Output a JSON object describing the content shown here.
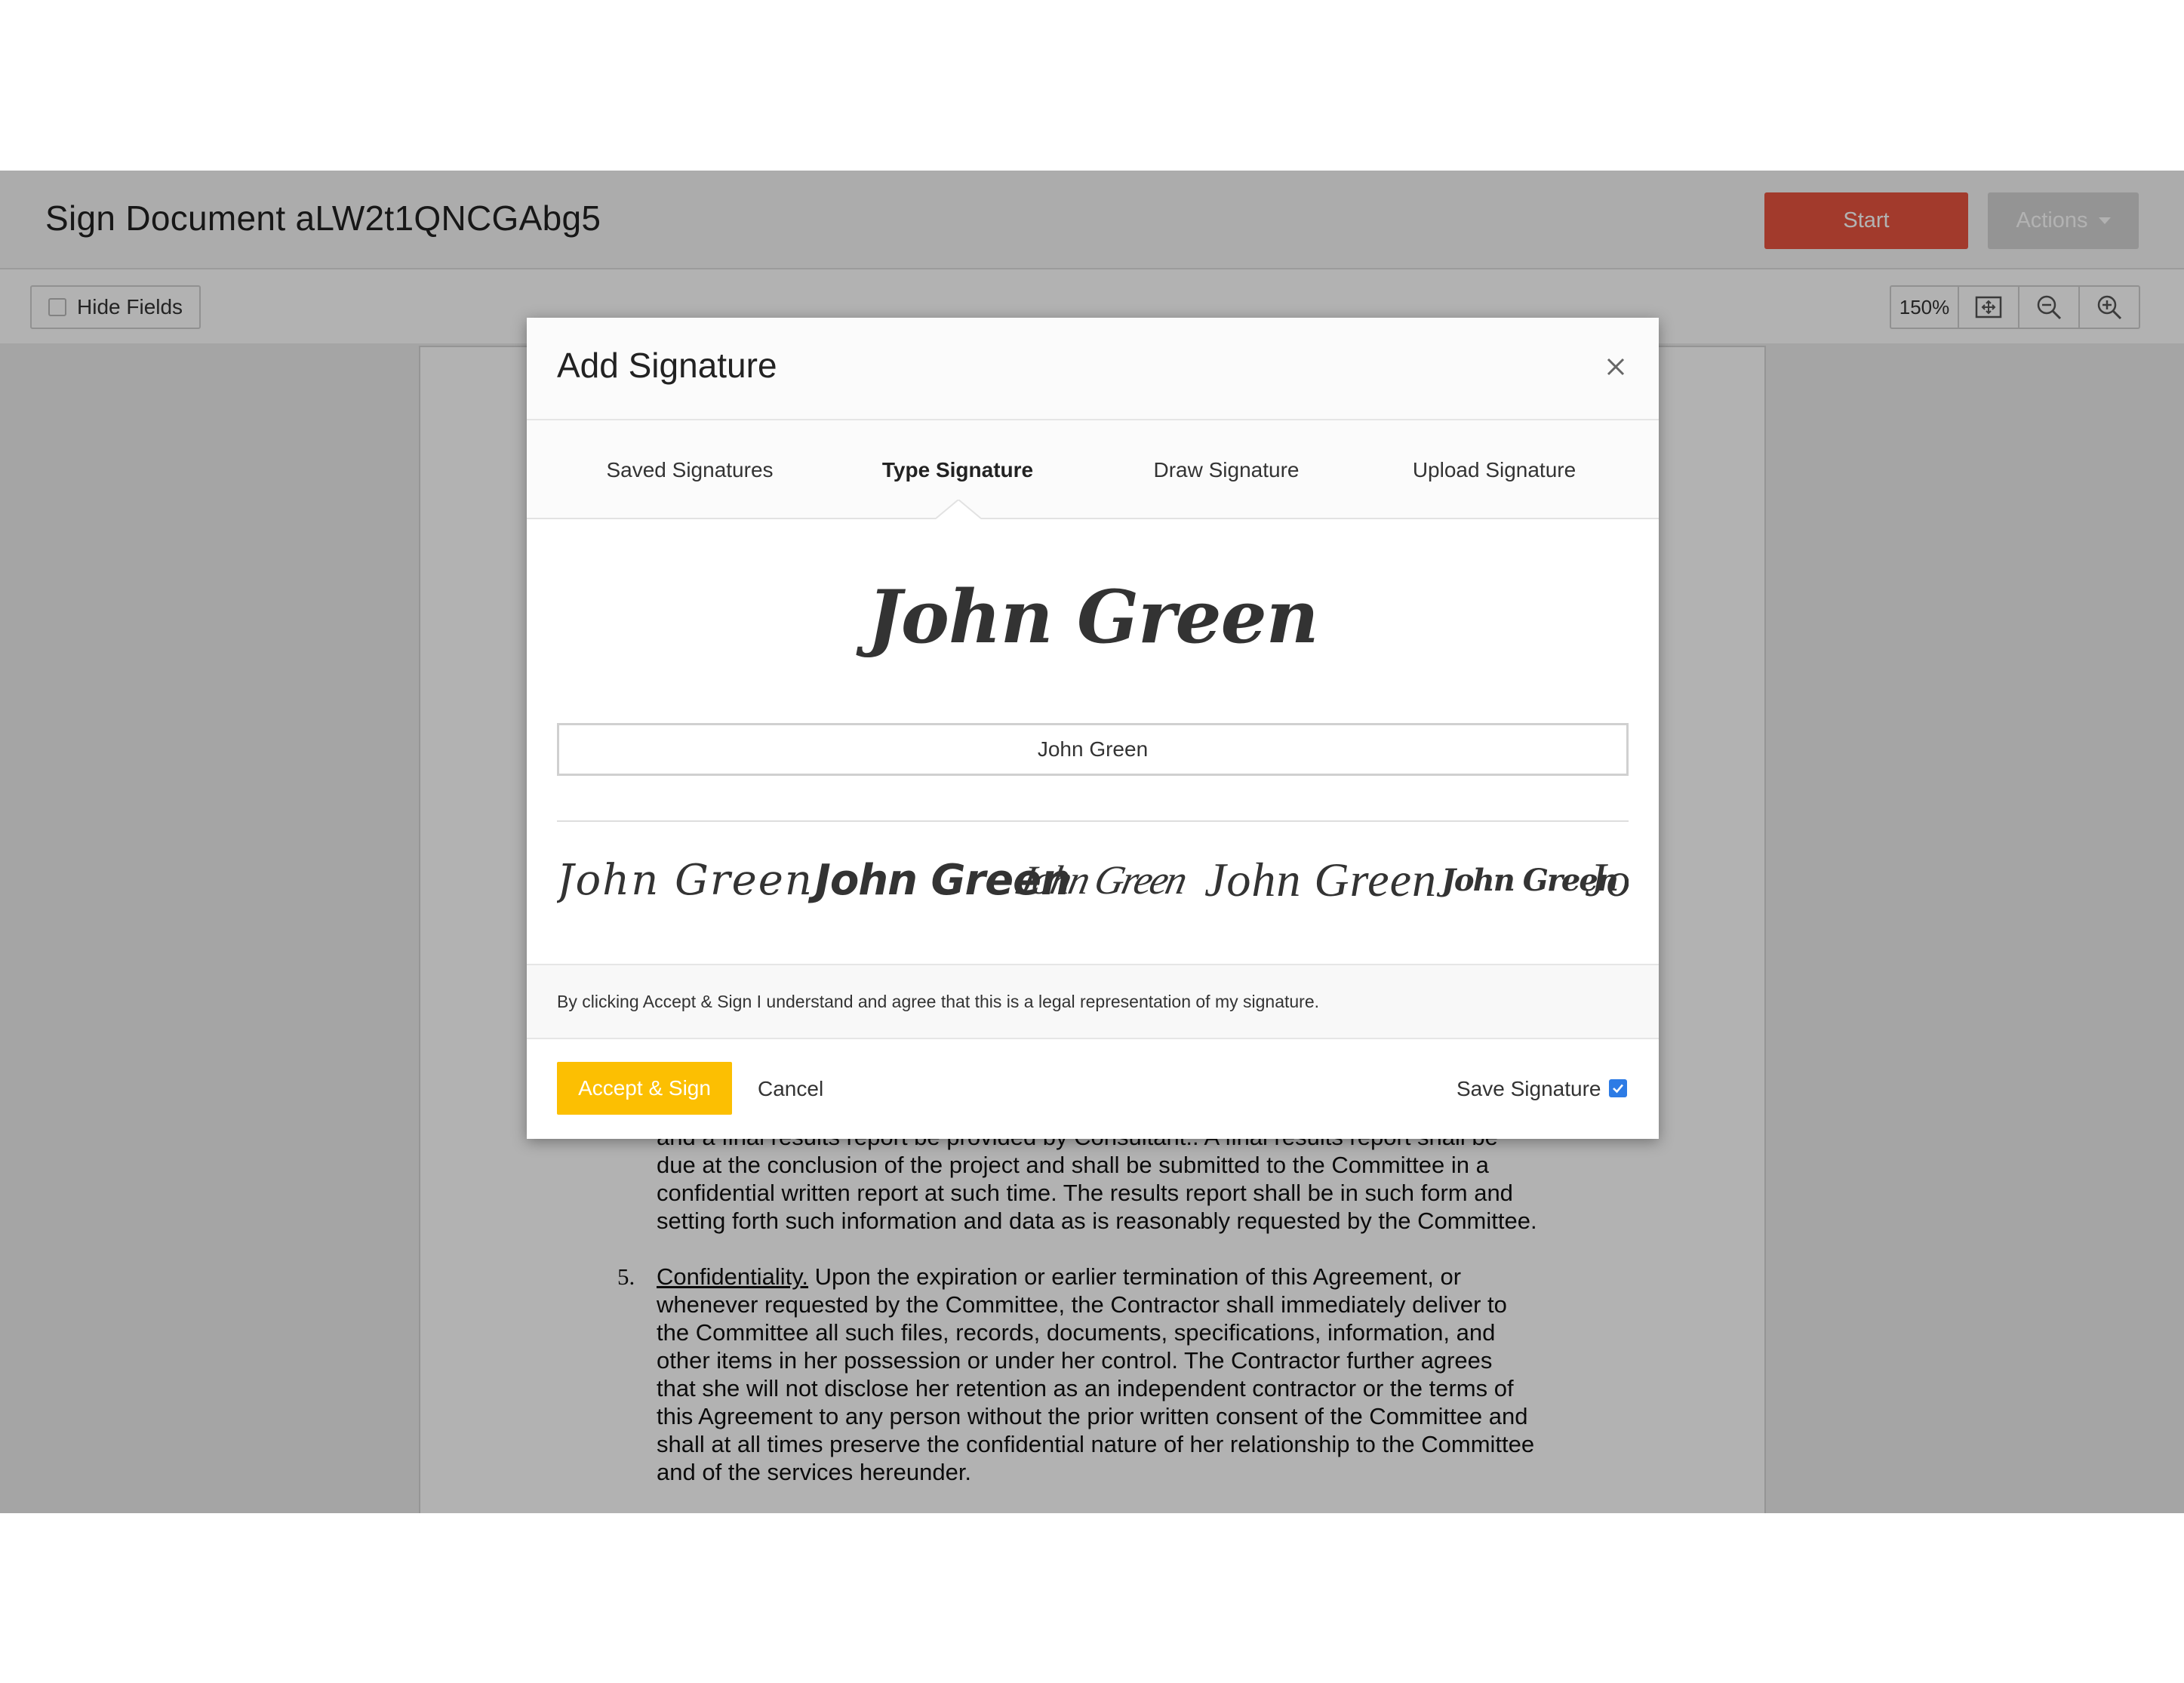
{
  "header": {
    "title": "Sign Document aLW2t1QNCGAbg5",
    "start_label": "Start",
    "actions_label": "Actions"
  },
  "toolbar": {
    "hide_fields_label": "Hide Fields",
    "zoom_level": "150%"
  },
  "document": {
    "lines": [
      "and a final results report be provided by Consultant..  A final results report shall be",
      "due at the conclusion of the project and shall be submitted to the Committee in a",
      "confidential written report at such time. The results report shall be in such form and",
      "setting forth such information and data as is reasonably requested by the Committee."
    ],
    "para5_num": "5.",
    "para5_heading": "Confidentiality.",
    "para5_first_rest": "  Upon the expiration or earlier termination of this Agreement, or",
    "para5_lines": [
      "whenever requested by the Committee, the Contractor shall immediately deliver to",
      "the Committee all such files, records, documents, specifications, information, and",
      "other items in her possession or under her control.  The Contractor further agrees",
      "that she will not disclose her retention as an independent contractor or the terms of",
      "this Agreement to any person without the prior written consent of the Committee and",
      "shall at all times preserve the confidential nature of her relationship to the Committee",
      "and of the services hereunder."
    ]
  },
  "modal": {
    "title": "Add Signature",
    "tabs": [
      "Saved Signatures",
      "Type Signature",
      "Draw Signature",
      "Upload Signature"
    ],
    "active_tab": "Type Signature",
    "preview_text": "John Green",
    "name_value": "John Green",
    "style_options": [
      "John Green",
      "John Green",
      "John Green",
      "John Green",
      "John Green",
      "John Green"
    ],
    "legal_text": "By clicking Accept & Sign I understand and agree that this is a legal representation of my signature.",
    "accept_label": "Accept & Sign",
    "cancel_label": "Cancel",
    "save_signature_label": "Save Signature",
    "save_signature_checked": true
  },
  "colors": {
    "start_button": "#e8543f",
    "accept_button": "#fcbf02",
    "checkbox_checked": "#2d7be5"
  }
}
